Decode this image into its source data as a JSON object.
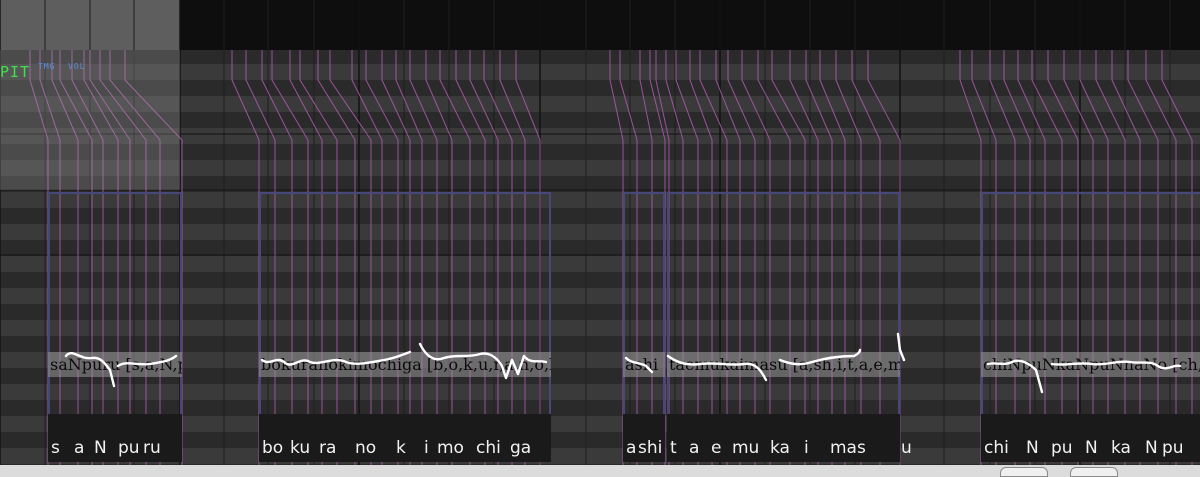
{
  "editor": {
    "mode_tabs": {
      "pitch": "PIT",
      "timing": "TMG",
      "volume": "VOL"
    },
    "active_tab": "pitch",
    "colors": {
      "note_border": "#47477a",
      "phoneme_line": "#b05ab0",
      "pitch_curve": "#ffffff",
      "active_tab": "#3fe14a",
      "inactive_tab": "#5a8fe0"
    }
  },
  "notes": [
    {
      "lyric": "saNpuru [s,a,N,p,u,r,u]",
      "phonemes": [
        "s",
        "a",
        "N",
        "pu",
        "ru"
      ]
    },
    {
      "lyric": "bokuranokimochiga [b,o,k,u,r,a,n,o,k,i,m,o,ch,i,g,a]",
      "phonemes": [
        "bo",
        "ku",
        "ra",
        "no",
        "k",
        "i",
        "mo",
        "chi",
        "ga"
      ]
    },
    {
      "lyric": "ashi",
      "phonemes": [
        "a",
        "shi"
      ]
    },
    {
      "lyric": "taemukaimasu [a,sh,i,t,a,e,m,u,k,a,i,m,a,s,u]",
      "phonemes": [
        "t",
        "a",
        "e",
        "mu",
        "ka",
        "i",
        "mas",
        "u"
      ]
    },
    {
      "lyric": "chiNpuNkaNpuNnaNo [ch,i,N,p,u,N,k,a,N,p,u,N]",
      "phonemes": [
        "chi",
        "N",
        "pu",
        "N",
        "ka",
        "N",
        "pu"
      ]
    }
  ]
}
